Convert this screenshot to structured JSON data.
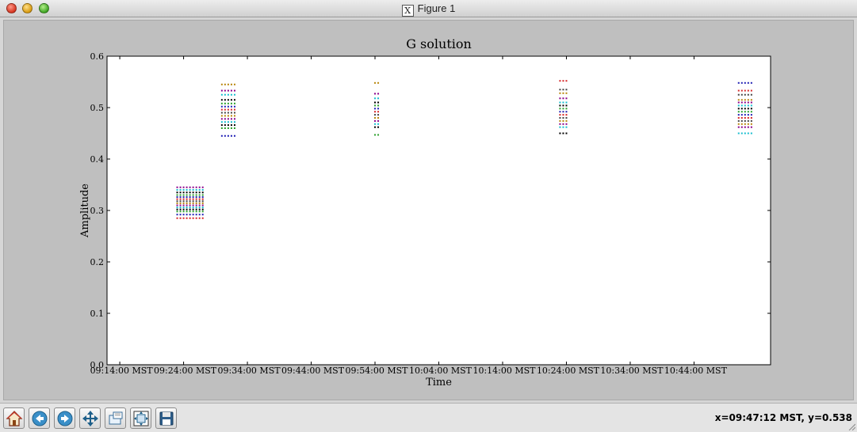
{
  "window": {
    "title": "Figure 1",
    "x_glyph": "X"
  },
  "toolbar": {
    "buttons": [
      {
        "name": "home-button",
        "icon": "home-icon"
      },
      {
        "name": "back-button",
        "icon": "arrow-left-icon"
      },
      {
        "name": "forward-button",
        "icon": "arrow-right-icon"
      },
      {
        "name": "pan-button",
        "icon": "move-icon"
      },
      {
        "name": "zoom-button",
        "icon": "zoom-rect-icon"
      },
      {
        "name": "subplots-button",
        "icon": "subplots-icon"
      },
      {
        "name": "save-button",
        "icon": "floppy-disk-icon"
      }
    ],
    "status": "x=09:47:12 MST, y=0.538"
  },
  "chart_data": {
    "type": "scatter",
    "title": "G solution",
    "xlabel": "Time",
    "ylabel": "Amplitude",
    "x_tick_labels": [
      "09:14:00 MST",
      "09:24:00 MST",
      "09:34:00 MST",
      "09:44:00 MST",
      "09:54:00 MST",
      "10:04:00 MST",
      "10:14:00 MST",
      "10:24:00 MST",
      "10:34:00 MST",
      "10:44:00 MST"
    ],
    "xlim": [
      "09:12:00",
      "10:56:00"
    ],
    "ylim": [
      0.0,
      0.6
    ],
    "y_ticks": [
      0.0,
      0.1,
      0.2,
      0.3,
      0.4,
      0.5,
      0.6
    ],
    "y_tick_labels": [
      "0.0",
      "0.1",
      "0.2",
      "0.3",
      "0.4",
      "0.5",
      "0.6"
    ],
    "grid": false,
    "legend": "none",
    "colors": [
      "#d62728",
      "#1f1fb4",
      "#2ca02c",
      "#000000",
      "#17becf",
      "#8b008b",
      "#b8860b",
      "#444444"
    ],
    "groups": [
      {
        "times": [
          "09:23:00",
          "09:23:30",
          "09:24:00",
          "09:24:30",
          "09:25:00",
          "09:25:30",
          "09:26:00",
          "09:26:30",
          "09:27:00"
        ],
        "amplitudes": [
          0.285,
          0.292,
          0.298,
          0.302,
          0.306,
          0.31,
          0.314,
          0.318,
          0.322,
          0.326,
          0.33,
          0.335,
          0.34,
          0.345
        ]
      },
      {
        "times": [
          "09:30:00",
          "09:30:30",
          "09:31:00",
          "09:31:30",
          "09:32:00"
        ],
        "amplitudes": [
          0.445,
          0.46,
          0.466,
          0.472,
          0.478,
          0.484,
          0.49,
          0.496,
          0.502,
          0.508,
          0.515,
          0.525,
          0.533,
          0.545
        ]
      },
      {
        "times": [
          "09:54:00",
          "09:54:30"
        ],
        "amplitudes": [
          0.447,
          0.462,
          0.468,
          0.474,
          0.48,
          0.486,
          0.492,
          0.498,
          0.504,
          0.51,
          0.518,
          0.527,
          0.548
        ]
      },
      {
        "times": [
          "10:23:00",
          "10:23:30",
          "10:24:00"
        ],
        "amplitudes": [
          0.45,
          0.462,
          0.468,
          0.474,
          0.48,
          0.486,
          0.492,
          0.498,
          0.504,
          0.51,
          0.518,
          0.528,
          0.535,
          0.552
        ]
      },
      {
        "times": [
          "10:51:00",
          "10:51:30",
          "10:52:00",
          "10:52:30",
          "10:53:00"
        ],
        "amplitudes": [
          0.45,
          0.462,
          0.468,
          0.474,
          0.48,
          0.486,
          0.492,
          0.498,
          0.504,
          0.51,
          0.515,
          0.525,
          0.533,
          0.548
        ]
      }
    ]
  }
}
